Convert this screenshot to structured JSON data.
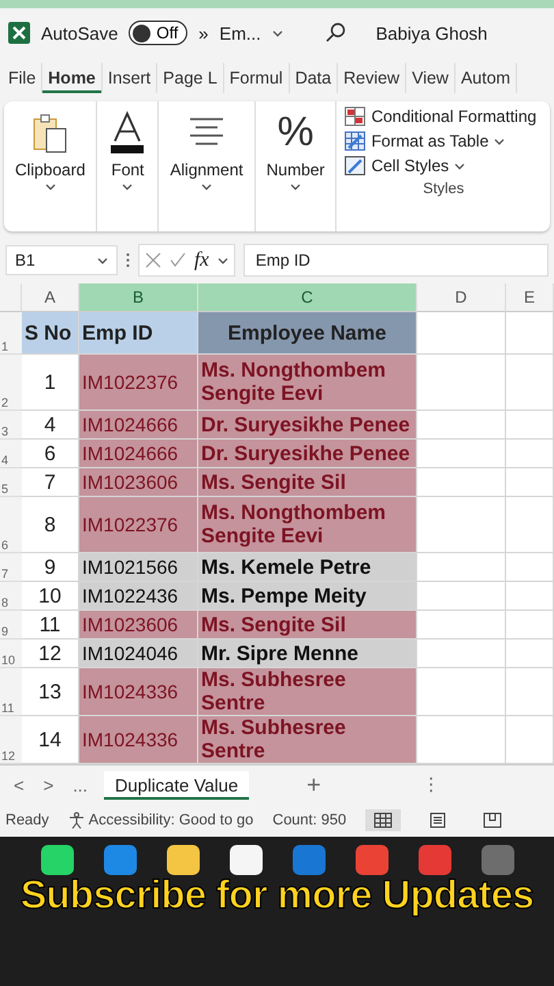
{
  "title_bar": {
    "autosave_label": "AutoSave",
    "autosave_on": false,
    "toggle_text": "Off",
    "more": "»",
    "file_name": "Em...",
    "user": "Babiya Ghosh"
  },
  "menu_tabs": [
    {
      "label": "File",
      "selected": false
    },
    {
      "label": "Home",
      "selected": true
    },
    {
      "label": "Insert",
      "selected": false
    },
    {
      "label": "Page L",
      "selected": false
    },
    {
      "label": "Formul",
      "selected": false
    },
    {
      "label": "Data",
      "selected": false
    },
    {
      "label": "Review",
      "selected": false
    },
    {
      "label": "View",
      "selected": false
    },
    {
      "label": "Autom",
      "selected": false
    }
  ],
  "ribbon": {
    "groups": [
      {
        "kind": "clipboard",
        "label": "Clipboard"
      },
      {
        "kind": "font",
        "label": "Font"
      },
      {
        "kind": "alignment",
        "label": "Alignment"
      },
      {
        "kind": "number",
        "label": "Number",
        "glyph": "%"
      }
    ],
    "styles": {
      "items": [
        {
          "kind": "conditional",
          "label": "Conditional Formatting",
          "dropdown": false
        },
        {
          "kind": "table",
          "label": "Format as Table",
          "dropdown": true
        },
        {
          "kind": "cellstyles",
          "label": "Cell Styles",
          "dropdown": true
        }
      ],
      "label": "Styles"
    }
  },
  "formula_bar": {
    "name_box": "B1",
    "fx": "fx",
    "formula": "Emp ID"
  },
  "columns": [
    {
      "label": "A",
      "selected": false
    },
    {
      "label": "B",
      "selected": true
    },
    {
      "label": "C",
      "selected": true
    },
    {
      "label": "D",
      "selected": false
    },
    {
      "label": "E",
      "selected": false
    }
  ],
  "table": {
    "header_row": "1",
    "headers": [
      "S No",
      "Emp ID",
      "Employee Name"
    ],
    "rows": [
      {
        "row": "2",
        "sno": "1",
        "emp_id": "IM1022376",
        "name": "Ms. Nongthombem Sengite Eevi",
        "duplicate": true
      },
      {
        "row": "3",
        "sno": "4",
        "emp_id": "IM1024666",
        "name": "Dr. Suryesikhe Penee",
        "duplicate": true
      },
      {
        "row": "4",
        "sno": "6",
        "emp_id": "IM1024666",
        "name": "Dr. Suryesikhe Penee",
        "duplicate": true
      },
      {
        "row": "5",
        "sno": "7",
        "emp_id": "IM1023606",
        "name": "Ms. Sengite Sil",
        "duplicate": true
      },
      {
        "row": "6",
        "sno": "8",
        "emp_id": "IM1022376",
        "name": "Ms. Nongthombem Sengite Eevi",
        "duplicate": true
      },
      {
        "row": "7",
        "sno": "9",
        "emp_id": "IM1021566",
        "name": "Ms. Kemele Petre",
        "duplicate": false
      },
      {
        "row": "8",
        "sno": "10",
        "emp_id": "IM1022436",
        "name": "Ms. Pempe Meity",
        "duplicate": false
      },
      {
        "row": "9",
        "sno": "11",
        "emp_id": "IM1023606",
        "name": "Ms. Sengite Sil",
        "duplicate": true
      },
      {
        "row": "10",
        "sno": "12",
        "emp_id": "IM1024046",
        "name": "Mr. Sipre Menne",
        "duplicate": false
      },
      {
        "row": "11",
        "sno": "13",
        "emp_id": "IM1024336",
        "name": "Ms. Subhesree Sentre",
        "duplicate": true
      },
      {
        "row": "12",
        "sno": "14",
        "emp_id": "IM1024336",
        "name": "Ms. Subhesree Sentre",
        "duplicate": true
      }
    ]
  },
  "sheet_tabs": {
    "prev": "<",
    "next": ">",
    "more": "...",
    "tabs": [
      {
        "label": "Duplicate Value",
        "selected": true
      }
    ],
    "add": "+",
    "menu": "⋮"
  },
  "status_bar": {
    "ready": "Ready",
    "accessibility": "Accessibility: Good to go",
    "count": "Count: 950",
    "views": [
      {
        "kind": "normal",
        "selected": true
      },
      {
        "kind": "page",
        "selected": false
      },
      {
        "kind": "break",
        "selected": false
      }
    ]
  },
  "taskbar": {
    "apps": [
      {
        "color": "#25d366"
      },
      {
        "color": "#1e88e5"
      },
      {
        "color": "#f4c542"
      },
      {
        "color": "#f5f5f5"
      },
      {
        "color": "#1976d2"
      },
      {
        "color": "#ea4335"
      },
      {
        "color": "#e53935"
      },
      {
        "color": "#6d6d6d"
      }
    ]
  },
  "caption": "Subscribe for more Updates"
}
